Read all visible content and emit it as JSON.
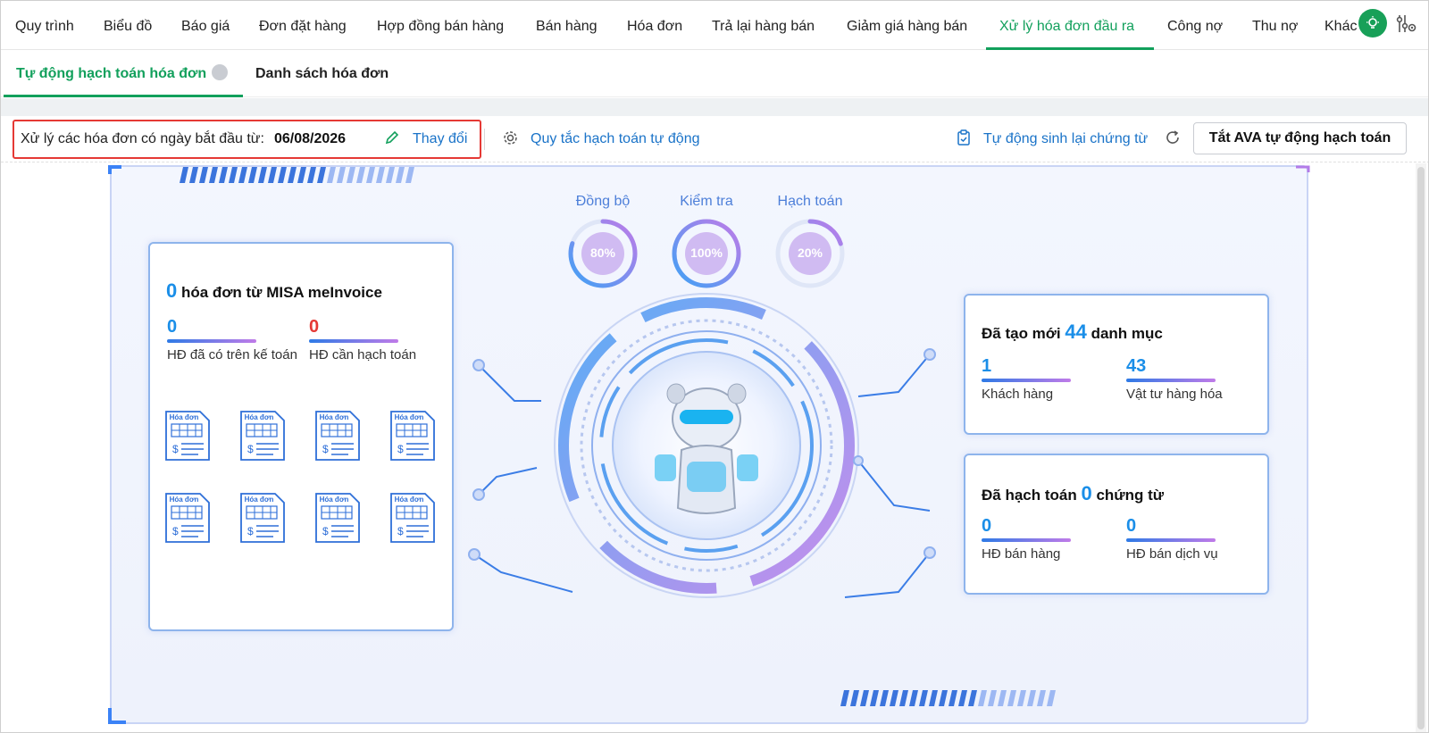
{
  "nav": {
    "items": [
      "Quy trình",
      "Biểu đồ",
      "Báo giá",
      "Đơn đặt hàng",
      "Hợp đồng bán hàng",
      "Bán hàng",
      "Hóa đơn",
      "Trả lại hàng bán",
      "Giảm giá hàng bán",
      "Xử lý hóa đơn đầu ra",
      "Công nợ",
      "Thu nợ",
      "Khác"
    ],
    "active": "Xử lý hóa đơn đầu ra"
  },
  "subtabs": {
    "auto": "Tự động hạch toán hóa đơn",
    "list": "Danh sách hóa đơn"
  },
  "toolbar": {
    "date_label": "Xử lý các hóa đơn có ngày bắt đầu từ:",
    "date_value": "06/08/2026",
    "change_link": "Thay đổi",
    "rules_link": "Quy tắc hạch toán tự động",
    "regen_link": "Tự động sinh lại chứng từ",
    "ava_button": "Tắt AVA tự động hạch toán"
  },
  "rings": [
    {
      "label": "Đồng bộ",
      "percent": "80%",
      "value": 0.8
    },
    {
      "label": "Kiểm tra",
      "percent": "100%",
      "value": 1.0
    },
    {
      "label": "Hạch toán",
      "percent": "20%",
      "value": 0.2
    }
  ],
  "invoices_card": {
    "count": "0",
    "title": "hóa đơn từ MISA meInvoice",
    "stat1_value": "0",
    "stat1_label": "HĐ đã có trên kế toán",
    "stat2_value": "0",
    "stat2_label": "HĐ cần hạch toán",
    "icon_label": "Hóa đơn"
  },
  "catalog_card": {
    "prefix": "Đã tạo mới",
    "count": "44",
    "suffix": "danh mục",
    "stat1_value": "1",
    "stat1_label": "Khách hàng",
    "stat2_value": "43",
    "stat2_label": "Vật tư hàng hóa"
  },
  "posted_card": {
    "prefix": "Đã hạch toán",
    "count": "0",
    "suffix": "chứng từ",
    "stat1_value": "0",
    "stat1_label": "HĐ bán hàng",
    "stat2_value": "0",
    "stat2_label": "HĐ bán dịch vụ"
  },
  "colors": {
    "accent": "#12a05c",
    "link": "#1a73c8",
    "number_blue": "#1a8ee8",
    "number_red": "#e53935"
  }
}
